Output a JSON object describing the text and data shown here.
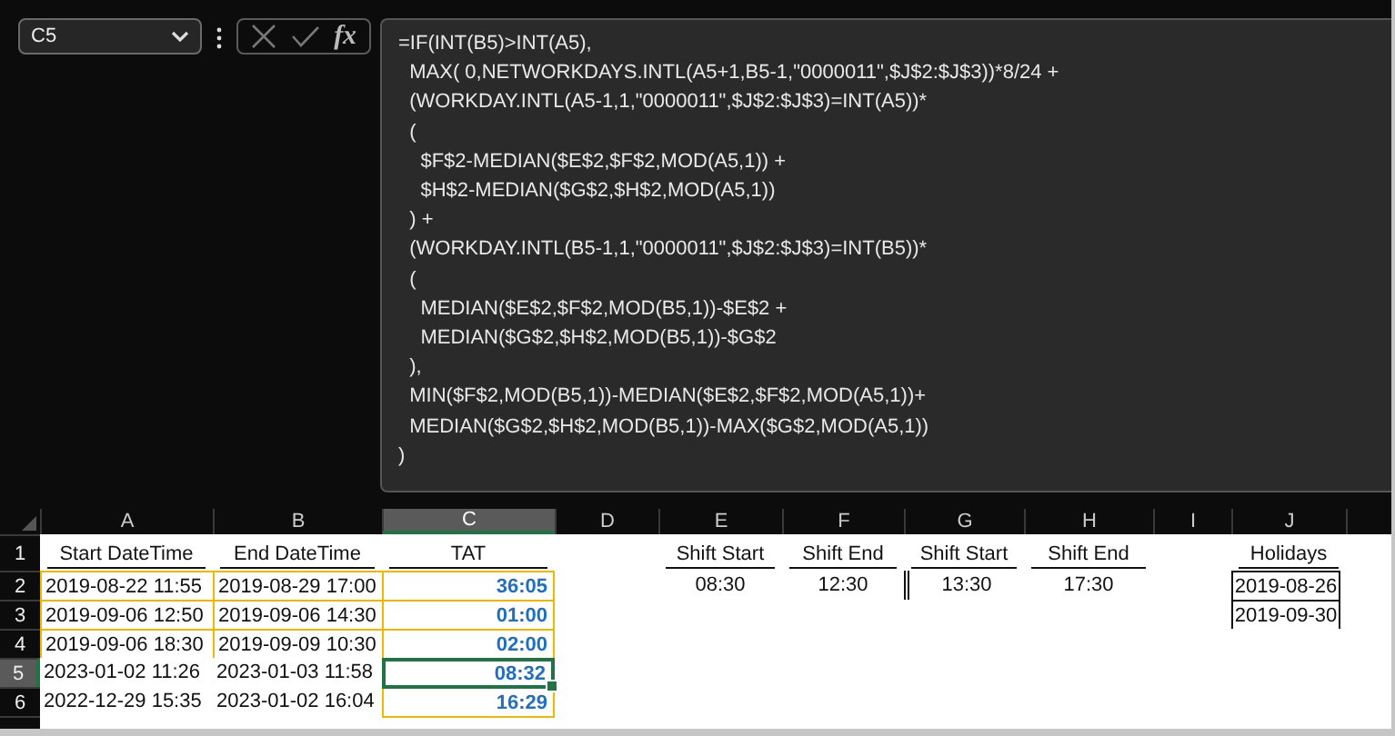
{
  "name_box": {
    "value": "C5"
  },
  "formula_bar": {
    "function_symbol": "fx",
    "lines": [
      "=IF(INT(B5)>INT(A5),",
      "  MAX( 0,NETWORKDAYS.INTL(A5+1,B5-1,\"0000011\",$J$2:$J$3))*8/24 +",
      "  (WORKDAY.INTL(A5-1,1,\"0000011\",$J$2:$J$3)=INT(A5))*",
      "  (",
      "    $F$2-MEDIAN($E$2,$F$2,MOD(A5,1)) +",
      "    $H$2-MEDIAN($G$2,$H$2,MOD(A5,1))",
      "  ) +",
      "  (WORKDAY.INTL(B5-1,1,\"0000011\",$J$2:$J$3)=INT(B5))*",
      "  (",
      "    MEDIAN($E$2,$F$2,MOD(B5,1))-$E$2 +",
      "    MEDIAN($G$2,$H$2,MOD(B5,1))-$G$2",
      "  ),",
      "  MIN($F$2,MOD(B5,1))-MEDIAN($E$2,$F$2,MOD(A5,1))+",
      "  MEDIAN($G$2,$H$2,MOD(B5,1))-MAX($G$2,MOD(A5,1))",
      ")"
    ]
  },
  "columns": [
    {
      "label": "A",
      "selected": false
    },
    {
      "label": "B",
      "selected": false
    },
    {
      "label": "C",
      "selected": true
    },
    {
      "label": "D",
      "selected": false
    },
    {
      "label": "E",
      "selected": false
    },
    {
      "label": "F",
      "selected": false
    },
    {
      "label": "G",
      "selected": false
    },
    {
      "label": "H",
      "selected": false
    },
    {
      "label": "I",
      "selected": false
    },
    {
      "label": "J",
      "selected": false
    }
  ],
  "rows": [
    {
      "number": "1",
      "selected": false,
      "cells": [
        {
          "kind": "label",
          "text": "Start DateTime"
        },
        {
          "kind": "label",
          "text": "End DateTime"
        },
        {
          "kind": "label",
          "text": "TAT"
        },
        {
          "kind": "empty"
        },
        {
          "kind": "label",
          "text": "Shift Start"
        },
        {
          "kind": "label",
          "text": "Shift End"
        },
        {
          "kind": "label",
          "text": "Shift Start"
        },
        {
          "kind": "label",
          "text": "Shift End"
        },
        {
          "kind": "empty"
        },
        {
          "kind": "label",
          "text": "Holidays"
        }
      ]
    },
    {
      "number": "2",
      "selected": false,
      "cells": [
        {
          "kind": "date_boxed",
          "text": "2019-08-22 11:55"
        },
        {
          "kind": "date_boxed",
          "text": "2019-08-29 17:00"
        },
        {
          "kind": "result",
          "text": "36:05",
          "active": false
        },
        {
          "kind": "empty"
        },
        {
          "kind": "time",
          "text": "08:30"
        },
        {
          "kind": "time",
          "text": "12:30"
        },
        {
          "kind": "time_divided",
          "text": "13:30"
        },
        {
          "kind": "time",
          "text": "17:30"
        },
        {
          "kind": "empty"
        },
        {
          "kind": "holiday",
          "text": "2019-08-26"
        }
      ]
    },
    {
      "number": "3",
      "selected": false,
      "cells": [
        {
          "kind": "date_boxed",
          "text": "2019-09-06 12:50"
        },
        {
          "kind": "date_boxed",
          "text": "2019-09-06 14:30"
        },
        {
          "kind": "result",
          "text": "01:00",
          "active": false
        },
        {
          "kind": "empty"
        },
        {
          "kind": "empty"
        },
        {
          "kind": "empty"
        },
        {
          "kind": "empty"
        },
        {
          "kind": "empty"
        },
        {
          "kind": "empty"
        },
        {
          "kind": "holiday",
          "text": "2019-09-30"
        }
      ]
    },
    {
      "number": "4",
      "selected": false,
      "cells": [
        {
          "kind": "date_boxed",
          "text": "2019-09-06 18:30"
        },
        {
          "kind": "date_boxed",
          "text": "2019-09-09 10:30"
        },
        {
          "kind": "result",
          "text": "02:00",
          "active": false
        },
        {
          "kind": "empty"
        },
        {
          "kind": "empty"
        },
        {
          "kind": "empty"
        },
        {
          "kind": "empty"
        },
        {
          "kind": "empty"
        },
        {
          "kind": "empty"
        },
        {
          "kind": "empty"
        }
      ]
    },
    {
      "number": "5",
      "selected": true,
      "cells": [
        {
          "kind": "date",
          "text": "2023-01-02 11:26"
        },
        {
          "kind": "date",
          "text": "2023-01-03 11:58"
        },
        {
          "kind": "result",
          "text": "08:32",
          "active": true
        },
        {
          "kind": "empty"
        },
        {
          "kind": "empty"
        },
        {
          "kind": "empty"
        },
        {
          "kind": "empty"
        },
        {
          "kind": "empty"
        },
        {
          "kind": "empty"
        },
        {
          "kind": "empty"
        }
      ]
    },
    {
      "number": "6",
      "selected": false,
      "cells": [
        {
          "kind": "date",
          "text": "2022-12-29 15:35"
        },
        {
          "kind": "date",
          "text": "2023-01-02 16:04"
        },
        {
          "kind": "result",
          "text": "16:29",
          "active": false
        },
        {
          "kind": "empty"
        },
        {
          "kind": "empty"
        },
        {
          "kind": "empty"
        },
        {
          "kind": "empty"
        },
        {
          "kind": "empty"
        },
        {
          "kind": "empty"
        },
        {
          "kind": "empty"
        }
      ]
    }
  ]
}
